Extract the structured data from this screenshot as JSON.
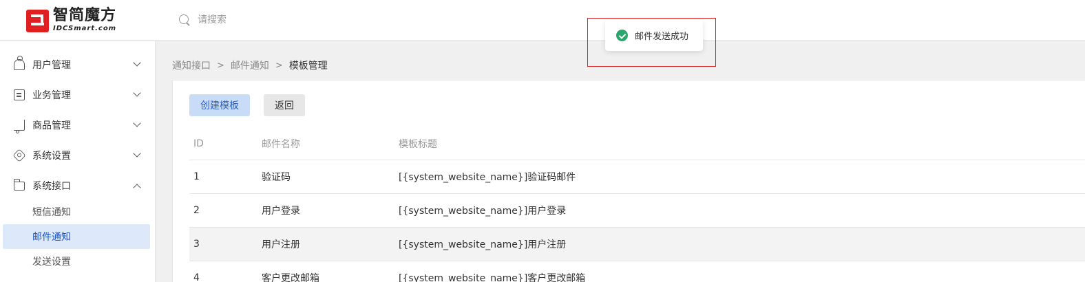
{
  "header": {
    "logo_cn": "智简魔方",
    "logo_en": "IDCSmart.com",
    "search_placeholder": "请搜索"
  },
  "sidebar": {
    "items": [
      {
        "label": "用户管理",
        "icon": "user-icon",
        "expanded": false
      },
      {
        "label": "业务管理",
        "icon": "document-icon",
        "expanded": false
      },
      {
        "label": "商品管理",
        "icon": "cart-icon",
        "expanded": false
      },
      {
        "label": "系统设置",
        "icon": "settings-icon",
        "expanded": false
      },
      {
        "label": "系统接口",
        "icon": "folder-icon",
        "expanded": true
      }
    ],
    "sub_items": [
      {
        "label": "短信通知",
        "active": false
      },
      {
        "label": "邮件通知",
        "active": true
      },
      {
        "label": "发送设置",
        "active": false
      }
    ]
  },
  "breadcrumb": {
    "items": [
      "通知接口",
      "邮件通知"
    ],
    "separator": ">",
    "current": "模板管理"
  },
  "toolbar": {
    "create_label": "创建模板",
    "back_label": "返回"
  },
  "table": {
    "headers": [
      "ID",
      "邮件名称",
      "模板标题"
    ],
    "rows": [
      {
        "id": "1",
        "name": "验证码",
        "title": "[{system_website_name}]验证码邮件"
      },
      {
        "id": "2",
        "name": "用户登录",
        "title": "[{system_website_name}]用户登录"
      },
      {
        "id": "3",
        "name": "用户注册",
        "title": "[{system_website_name}]用户注册"
      },
      {
        "id": "4",
        "name": "客户更改邮箱",
        "title": "[{system_website_name}]客户更改邮箱"
      }
    ]
  },
  "toast": {
    "message": "邮件发送成功",
    "type": "success",
    "color": "#2aa86b"
  },
  "colors": {
    "accent": "#1a56c4",
    "active_bg": "#dde8fb",
    "highlight": "#e02020"
  }
}
